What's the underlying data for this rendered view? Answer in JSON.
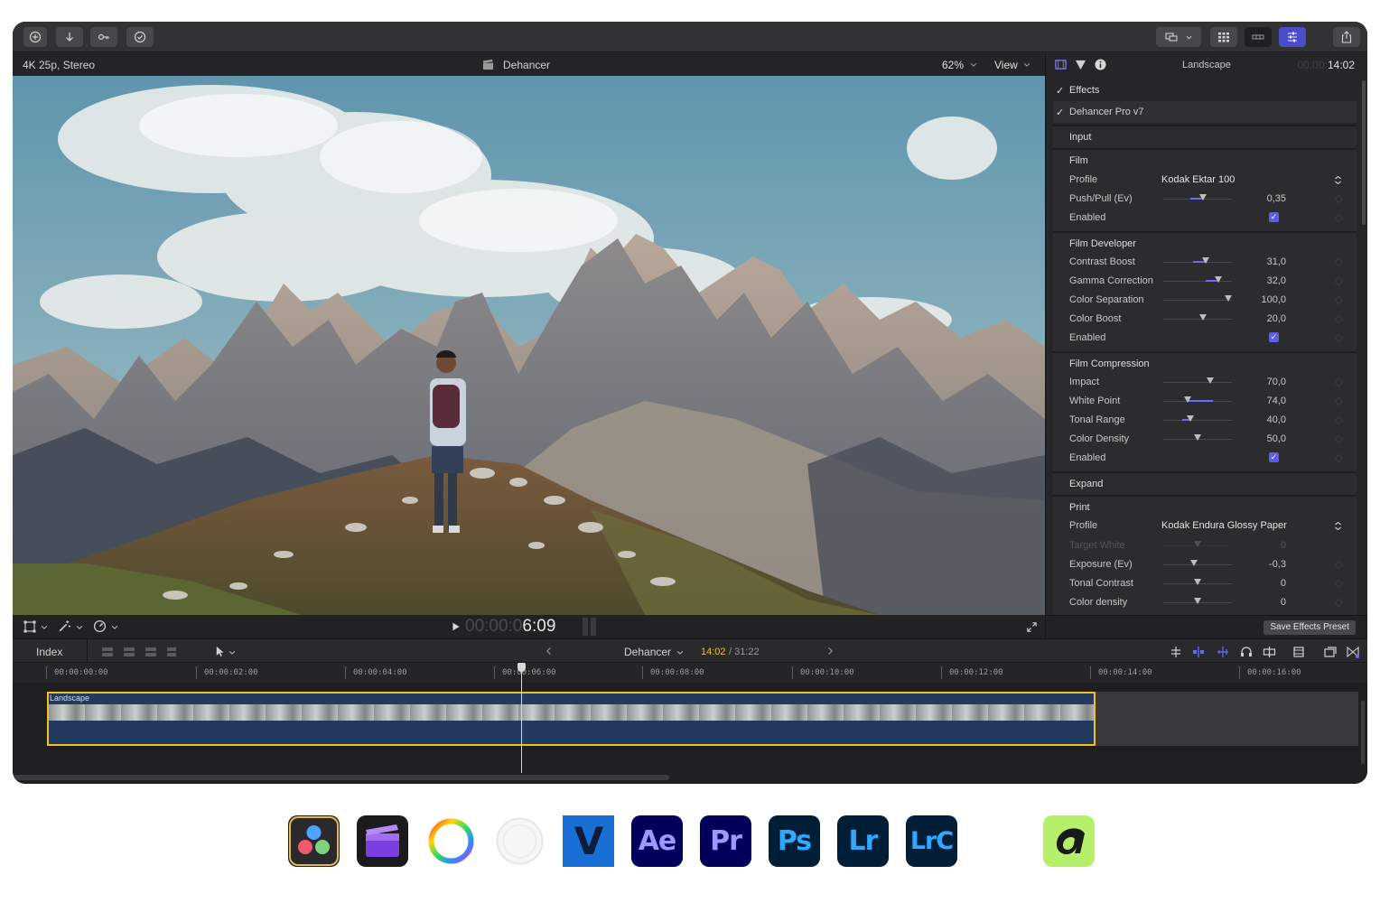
{
  "viewer": {
    "format": "4K 25p, Stereo",
    "project": "Dehancer",
    "zoom": "62%",
    "view_label": "View",
    "timecode_dim": "00:00:0",
    "timecode_bright": "6:09"
  },
  "inspector": {
    "clip_name": "Landscape",
    "duration_dim": "00:00:",
    "duration_bright": "14:02",
    "effects_label": "Effects",
    "plugin_label": "Dehancer Pro v7",
    "save_preset": "Save Effects Preset",
    "sections": {
      "input": "Input",
      "film": "Film",
      "film_developer": "Film Developer",
      "film_compression": "Film Compression",
      "expand": "Expand",
      "print": "Print"
    },
    "film_profile_label": "Profile",
    "film_profile_value": "Kodak Ektar 100",
    "print_profile_label": "Profile",
    "print_profile_value": "Kodak Endura Glossy Paper",
    "enabled_label": "Enabled",
    "params": [
      {
        "label": "Push/Pull (Ev)",
        "value": "0,35",
        "level": 0.58
      },
      {
        "label": "Contrast Boost",
        "value": "31,0",
        "level": 0.62
      },
      {
        "label": "Gamma Correction",
        "value": "32,0",
        "level": 0.8
      },
      {
        "label": "Color Separation",
        "value": "100,0",
        "level": 0.95
      },
      {
        "label": "Color Boost",
        "value": "20,0",
        "level": 0.58
      },
      {
        "label": "Impact",
        "value": "70,0",
        "level": 0.68
      },
      {
        "label": "White Point",
        "value": "74,0",
        "level": 0.35
      },
      {
        "label": "Tonal Range",
        "value": "40,0",
        "level": 0.4
      },
      {
        "label": "Color Density",
        "value": "50,0",
        "level": 0.5
      },
      {
        "label": "Target White",
        "value": "0",
        "level": 0.5
      },
      {
        "label": "Exposure (Ev)",
        "value": "-0,3",
        "level": 0.45
      },
      {
        "label": "Tonal Contrast",
        "value": "0",
        "level": 0.5
      },
      {
        "label": "Color density",
        "value": "0",
        "level": 0.5
      }
    ]
  },
  "timeline": {
    "index_label": "Index",
    "project": "Dehancer",
    "position": "14:02",
    "total": "/ 31:22",
    "clip_label": "Landscape",
    "ruler": [
      "00:00:00:00",
      "00:00:02:00",
      "00:00:04:00",
      "00:00:06:00",
      "00:00:08:00",
      "00:00:10:00",
      "00:00:12:00",
      "00:00:14:00",
      "00:00:16:00"
    ]
  },
  "dock": {
    "ae": "Ae",
    "pr": "Pr",
    "ps": "Ps",
    "lr": "Lr",
    "lrc": "LrC",
    "v": "V"
  },
  "colors": {
    "accent": "#5b5cf0",
    "clip_border": "#f2c316",
    "timecode_yellow": "#e8c23a"
  }
}
